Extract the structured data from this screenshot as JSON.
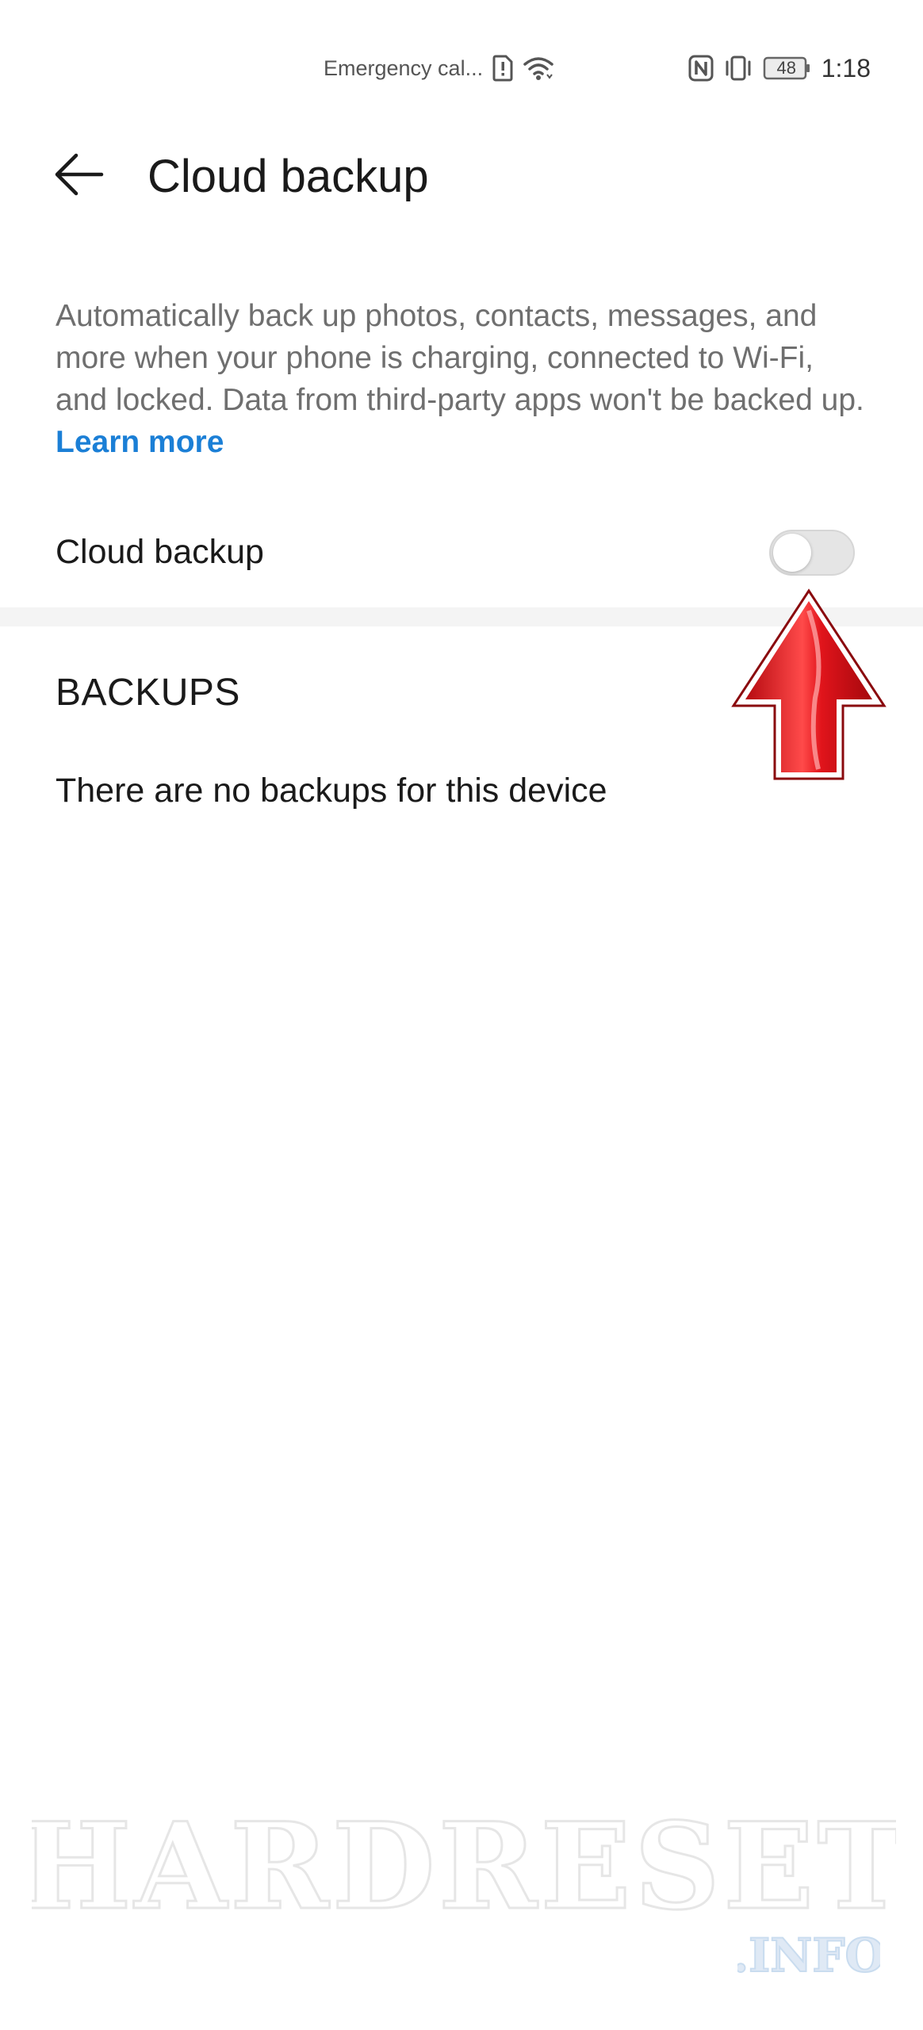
{
  "status_bar": {
    "carrier_text": "Emergency cal...",
    "time": "1:18",
    "battery_level": "48",
    "icons": [
      "sim-alert-icon",
      "wifi-icon",
      "nfc-icon",
      "vibrate-icon",
      "battery-icon"
    ]
  },
  "app_bar": {
    "title": "Cloud backup",
    "back_icon": "arrow-left-icon"
  },
  "description": {
    "text": "Automatically back up photos, contacts, messages, and more when your phone is charging, connected to Wi-Fi, and locked. Data from third-party apps won't be backed up. ",
    "link_label": "Learn more",
    "link_color": "#1b7fd6"
  },
  "toggle": {
    "label": "Cloud backup",
    "state": "off"
  },
  "backups": {
    "header": "BACKUPS",
    "empty_message": "There are no backups for this device"
  },
  "annotation": {
    "icon": "red-up-arrow-icon",
    "color": "#e0141b"
  },
  "watermark": {
    "text": "HARDRESET",
    "sub_text": ".INFO"
  }
}
